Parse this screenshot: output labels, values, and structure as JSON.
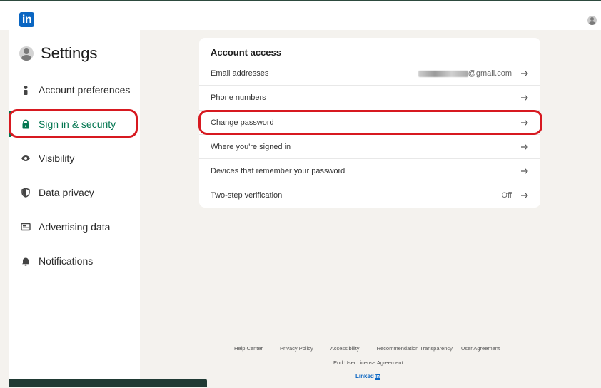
{
  "header": {
    "logo_text": "in"
  },
  "sidebar": {
    "title": "Settings",
    "items": [
      {
        "label": "Account preferences",
        "icon": "person-icon"
      },
      {
        "label": "Sign in & security",
        "icon": "lock-icon",
        "active": true
      },
      {
        "label": "Visibility",
        "icon": "eye-icon"
      },
      {
        "label": "Data privacy",
        "icon": "shield-icon"
      },
      {
        "label": "Advertising data",
        "icon": "ad-card-icon"
      },
      {
        "label": "Notifications",
        "icon": "bell-icon"
      }
    ]
  },
  "account_access": {
    "title": "Account access",
    "rows": [
      {
        "label": "Email addresses",
        "value": "@gmail.com"
      },
      {
        "label": "Phone numbers",
        "value": ""
      },
      {
        "label": "Change password",
        "value": ""
      },
      {
        "label": "Where you're signed in",
        "value": ""
      },
      {
        "label": "Devices that remember your password",
        "value": ""
      },
      {
        "label": "Two-step verification",
        "value": "Off"
      }
    ]
  },
  "footer": {
    "links": [
      "Help Center",
      "Privacy Policy",
      "Accessibility",
      "Recommendation Transparency",
      "User Agreement"
    ],
    "line2": "End User License Agreement",
    "brand_text": "Linked",
    "brand_box": "in"
  },
  "colors": {
    "accent_green": "#01754f",
    "brand_blue": "#0a66c2",
    "annotation_red": "#d71920",
    "page_bg": "#f4f2ee"
  }
}
